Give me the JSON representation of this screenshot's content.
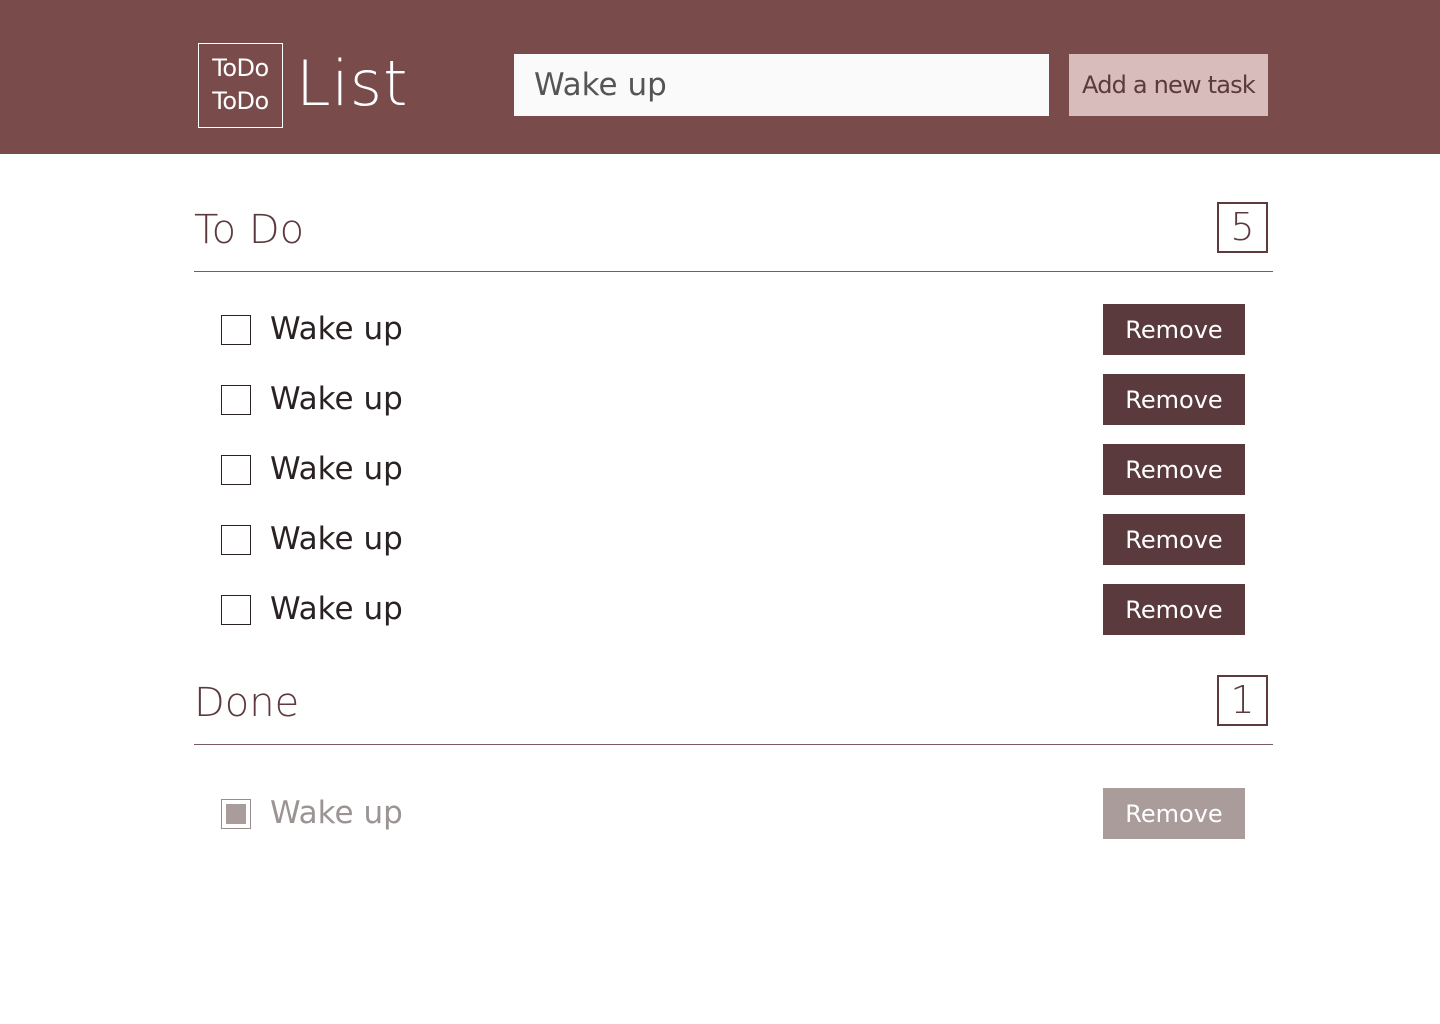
{
  "header": {
    "logo_line1": "ToDo",
    "logo_line2": "ToDo",
    "logo_word": "List",
    "input_value": "Wake up",
    "add_button_label": "Add a new task"
  },
  "todo": {
    "title": "To Do",
    "count": "5",
    "items": [
      {
        "label": "Wake up",
        "checked": false,
        "remove_label": "Remove"
      },
      {
        "label": "Wake up",
        "checked": false,
        "remove_label": "Remove"
      },
      {
        "label": "Wake up",
        "checked": false,
        "remove_label": "Remove"
      },
      {
        "label": "Wake up",
        "checked": false,
        "remove_label": "Remove"
      },
      {
        "label": "Wake up",
        "checked": false,
        "remove_label": "Remove"
      }
    ]
  },
  "done": {
    "title": "Done",
    "count": "1",
    "items": [
      {
        "label": "Wake up",
        "checked": true,
        "remove_label": "Remove"
      }
    ]
  },
  "colors": {
    "header_bg": "#7a4b4b",
    "accent": "#5a3a3c",
    "add_button_bg": "#d8bcbc",
    "done_muted": "#ab9c9c"
  }
}
